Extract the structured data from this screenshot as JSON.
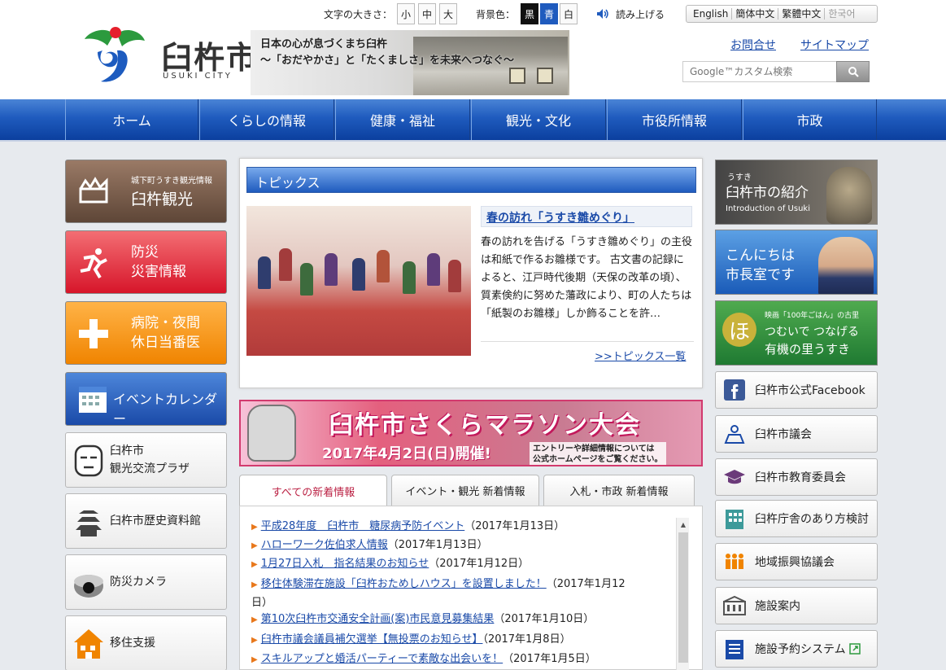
{
  "header": {
    "logo_name": "臼杵市",
    "logo_sub": "USUKI CITY",
    "banner_line1": "日本の心が息づくまち臼杵",
    "banner_line2": "～「おだやかさ」と「たくましさ」を未来へつなぐ～",
    "font_size_label": "文字の大きさ：",
    "font_sizes": [
      "小",
      "中",
      "大"
    ],
    "bg_label": "背景色：",
    "bg_colors": [
      "黒",
      "青",
      "白"
    ],
    "read_aloud": "読み上げる",
    "languages": [
      "English",
      "簡体中文",
      "繁體中文",
      "한국어"
    ],
    "contact": "お問合せ",
    "sitemap": "サイトマップ",
    "search_placeholder": "Google™カスタム検索"
  },
  "nav": [
    "ホーム",
    "くらしの情報",
    "健康・福祉",
    "観光・文化",
    "市役所情報",
    "市政"
  ],
  "left": {
    "tourism_sub": "城下町うすき観光情報",
    "tourism": "臼杵観光",
    "disaster_1": "防災",
    "disaster_2": "災害情報",
    "hospital_1": "病院・夜間",
    "hospital_2": "休日当番医",
    "calendar": "イベントカレンダー",
    "plaza_1": "臼杵市",
    "plaza_2": "観光交流プラザ",
    "history": "臼杵市歴史資料館",
    "camera": "防災カメラ",
    "migration": "移住支援"
  },
  "topics": {
    "heading": "トピックス",
    "title": "春の訪れ「うすき雛めぐり」",
    "body": "春の訪れを告げる「うすき雛めぐり」の主役は和紙で作るお雛様です。 古文書の記録によると、江戸時代後期（天保の改革の頃）、質素倹約に努めた藩政により、町の人たちは「紙製のお雛様」しか飾ることを許…",
    "more": ">>トピックス一覧"
  },
  "marathon": {
    "title": "臼杵市さくらマラソン大会",
    "date": "2017年4月2日(日)開催!",
    "note_1": "エントリーや詳細情報については",
    "note_2": "公式ホームページをご覧ください。"
  },
  "tabs": [
    "すべての新着情報",
    "イベント・観光 新着情報",
    "入札・市政 新着情報"
  ],
  "news": [
    {
      "title": "平成28年度　臼杵市　糖尿病予防イベント",
      "date": "（2017年1月13日）"
    },
    {
      "title": "ハローワーク佐伯求人情報",
      "date": "（2017年1月13日）"
    },
    {
      "title": "1月27日入札　指名結果のお知らせ",
      "date": "（2017年1月12日）"
    },
    {
      "title": "移住体験滞在施設「臼杵おためしハウス」を設置しました！",
      "date": "（2017年1月12",
      "date2": "日）"
    },
    {
      "title": "第10次臼杵市交通安全計画(案)市民意見募集結果",
      "date": "（2017年1月10日）"
    },
    {
      "title": "臼杵市議会議員補欠選挙【無投票のお知らせ】",
      "date": "（2017年1月8日）"
    },
    {
      "title": "スキルアップと婚活パーティーで素敵な出会いを！",
      "date": "（2017年1月5日）"
    }
  ],
  "right": {
    "intro_sub": "うすき",
    "intro": "臼杵市の紹介",
    "intro_en": "Introduction of Usuki",
    "mayor_1": "こんにちは",
    "mayor_2": "市長室です",
    "organic_sub": "映画「100年ごはん」の古里",
    "organic_1": "つむいで つなげる",
    "organic_2": "有機の里うすき",
    "organic_mark": "ほ",
    "buttons": [
      "臼杵市公式Facebook",
      "臼杵市議会",
      "臼杵市教育委員会",
      "臼杵庁舎のあり方検討",
      "地域振興協議会",
      "施設案内",
      "施設予約システム"
    ]
  },
  "colors": {
    "nav": "#1f5bbe",
    "link": "#1a4aa8",
    "accent_orange": "#e8781c"
  }
}
